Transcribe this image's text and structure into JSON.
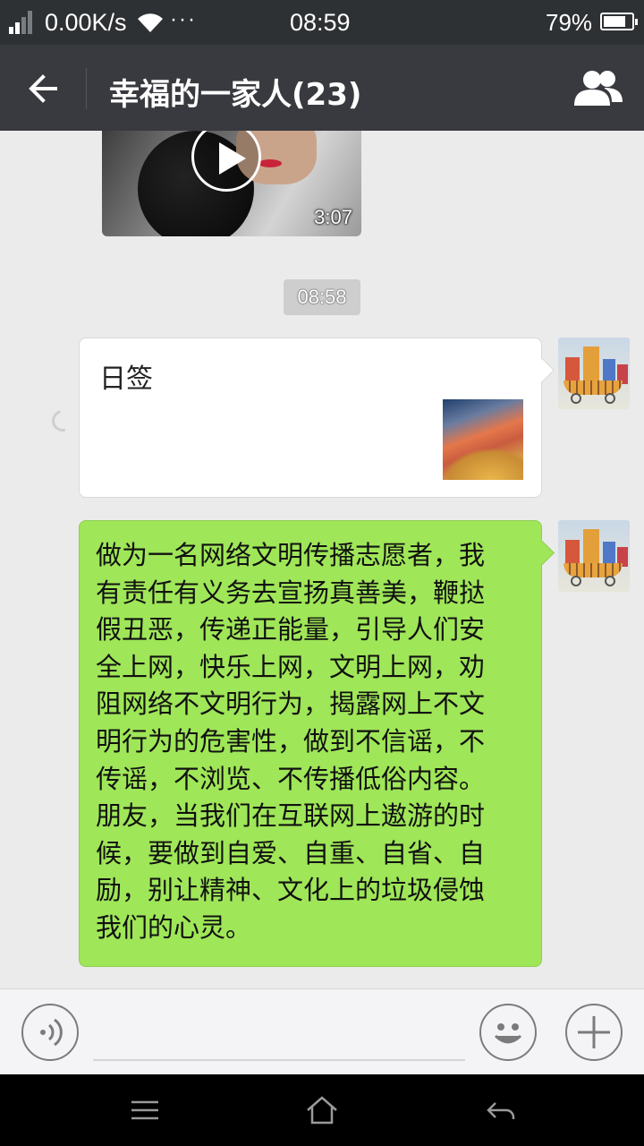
{
  "status_bar": {
    "net_speed": "0.00K/s",
    "dots": "···",
    "time": "08:59",
    "battery_percent": "79%",
    "battery_level": 0.79
  },
  "header": {
    "back_icon": "arrow-left-icon",
    "title": "幸福的一家人(23)",
    "members_icon": "group-members-icon"
  },
  "chat": {
    "video_message": {
      "duration": "3:07",
      "play_icon": "play-icon"
    },
    "timestamp": "08:58",
    "link_card": {
      "title": "日签"
    },
    "text_message": {
      "text": "做为一名网络文明传播志愿者，我\n有责任有义务去宣扬真善美，鞭挞\n假丑恶，传递正能量，引导人们安\n全上网，快乐上网，文明上网，劝\n阻网络不文明行为，揭露网上不文\n明行为的危害性，做到不信谣，不\n传谣，不浏览、不传播低俗内容。\n朋友，当我们在互联网上遨游的时\n候，要做到自爱、自重、自省、自\n励，别让精神、文化上的垃圾侵蚀\n我们的心灵。"
    }
  },
  "input_bar": {
    "voice_icon": "voice-input-icon",
    "emoji_icon": "emoji-icon",
    "plus_icon": "plus-icon"
  },
  "nav_bar": {
    "menu_icon": "menu-icon",
    "home_icon": "home-icon",
    "back_icon": "back-icon"
  },
  "colors": {
    "header_bg": "#393a3f",
    "chat_bg": "#ebebeb",
    "sent_bubble": "#9fe658"
  }
}
